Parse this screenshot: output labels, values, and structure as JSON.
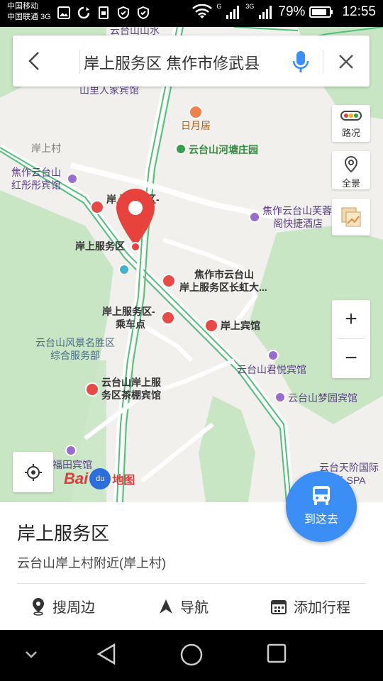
{
  "status_bar": {
    "carrier1": "中国移动",
    "carrier2": "中国联通 3G",
    "network1": "G",
    "network2": "3G",
    "battery": "79%",
    "time": "12:55"
  },
  "search": {
    "query": "岸上服务区 焦作市修武县"
  },
  "controls": {
    "traffic_label": "路况",
    "panorama_label": "全景",
    "zoom_in": "+",
    "zoom_out": "−"
  },
  "map_labels": {
    "top_partial": "云台山山水",
    "shanli": "山里人家宾馆",
    "riyueju": "日月居",
    "hetang": "云台山河塘庄园",
    "anshangcun": "岸上村",
    "hongbin_1": "焦作云台山",
    "hongbin_2": "红彤彤宾馆",
    "fuwuqu_partial": "岸上服务区-",
    "furong_1": "焦作云台山芙蓉",
    "furong_2": "阁快捷酒店",
    "service_area": "岸上服务区",
    "changhong_1": "焦作市云台山",
    "changhong_2": "岸上服务区长虹大...",
    "bus_1": "岸上服务区-",
    "bus_2": "乘车点",
    "anshang_hotel": "岸上宾馆",
    "scenic_1": "云台山风景名胜区",
    "scenic_2": "综合服务部",
    "junyue": "云台山君悦宾馆",
    "chapeng_1": "云台山岸上服",
    "chapeng_2": "务区茶棚宾馆",
    "mengyuan": "云台山梦园宾馆",
    "futian": "福田宾馆",
    "tianjie_1": "云台天阶国际",
    "tianjie_2": "店-SPA"
  },
  "logo": {
    "brand": "Bai",
    "du": "du",
    "map": "地图"
  },
  "go_here": {
    "label": "到这去"
  },
  "place": {
    "title": "岸上服务区",
    "address": "云台山岸上村附近(岸上村)"
  },
  "actions": {
    "nearby": "搜周边",
    "navigate": "导航",
    "add_trip": "添加行程"
  },
  "colors": {
    "accent": "#3a8ef6",
    "marker_red": "#e8423c",
    "green_area": "#c9e6c4",
    "road_green": "#4fc07a"
  }
}
